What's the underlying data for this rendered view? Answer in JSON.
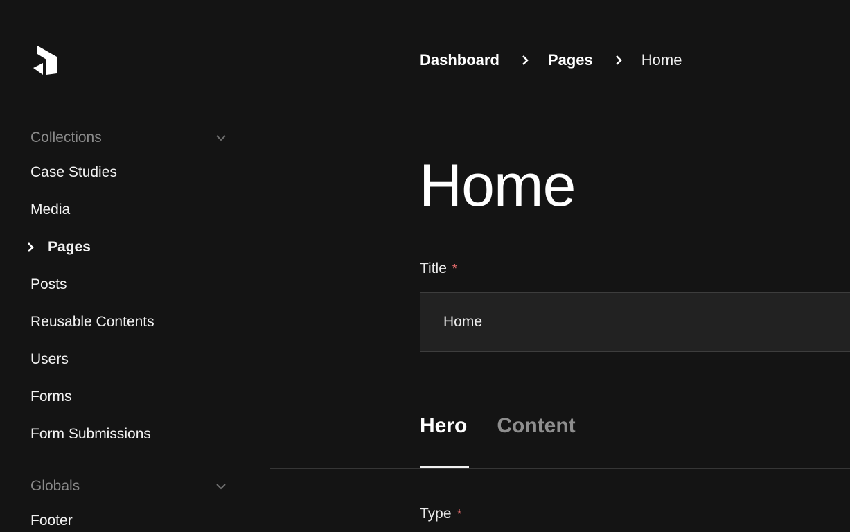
{
  "sidebar": {
    "collections_label": "Collections",
    "collections": [
      {
        "label": "Case Studies"
      },
      {
        "label": "Media"
      },
      {
        "label": "Pages",
        "active": true
      },
      {
        "label": "Posts"
      },
      {
        "label": "Reusable Contents"
      },
      {
        "label": "Users"
      },
      {
        "label": "Forms"
      },
      {
        "label": "Form Submissions"
      }
    ],
    "globals_label": "Globals",
    "globals": [
      {
        "label": "Footer"
      }
    ]
  },
  "breadcrumb": {
    "items": [
      "Dashboard",
      "Pages"
    ],
    "current": "Home"
  },
  "page": {
    "title": "Home",
    "title_field": {
      "label": "Title",
      "required_mark": "*",
      "value": "Home"
    },
    "tabs": [
      {
        "label": "Hero",
        "active": true
      },
      {
        "label": "Content",
        "active": false
      }
    ],
    "type_field": {
      "label": "Type",
      "required_mark": "*"
    }
  },
  "colors": {
    "background": "#141414",
    "required": "#e06a6a",
    "muted_text": "#8a8a8a",
    "input_background": "#222222"
  },
  "icons": [
    "payload-logo-icon",
    "chevron-down-icon",
    "chevron-right-icon"
  ]
}
